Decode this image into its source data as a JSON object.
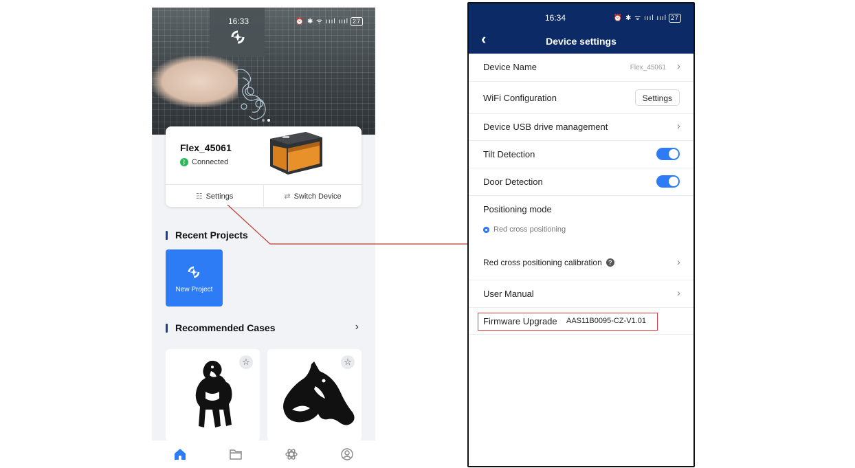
{
  "left_phone": {
    "status_bar": {
      "time": "16:33",
      "indicators": "⏰ ✱ ᯤ ıııl ıııl",
      "battery": "27"
    },
    "device": {
      "name": "Flex_45061",
      "status": "Connected"
    },
    "actions": {
      "settings": "Settings",
      "switch_device": "Switch Device"
    },
    "recent_projects": {
      "title": "Recent Projects",
      "new_project": "New Project"
    },
    "recommended": {
      "title": "Recommended Cases"
    },
    "tabbar_icons": [
      "home-icon",
      "folder-icon",
      "atom-icon",
      "profile-icon"
    ]
  },
  "right_phone": {
    "status_bar": {
      "time": "16:34",
      "indicators": "⏰ ✱ ᯤ ıııl ıııl",
      "battery": "27"
    },
    "title": "Device settings",
    "rows": {
      "device_name": {
        "label": "Device Name",
        "value": "Flex_45061"
      },
      "wifi": {
        "label": "WiFi Configuration",
        "button": "Settings"
      },
      "usb": {
        "label": "Device USB drive management"
      },
      "tilt": {
        "label": "Tilt Detection",
        "enabled": true
      },
      "door": {
        "label": "Door Detection",
        "enabled": true
      },
      "positioning": {
        "label": "Positioning mode",
        "option": "Red cross positioning"
      },
      "calibration": {
        "label": "Red cross positioning calibration"
      },
      "manual": {
        "label": "User Manual"
      },
      "firmware": {
        "label": "Firmware Upgrade",
        "version": "AAS11B0095-CZ-V1.01"
      }
    }
  },
  "colors": {
    "header_navy": "#0b2a66",
    "accent_blue": "#2d7cf6",
    "highlight_red": "#d9363e",
    "connected_green": "#2bb95b"
  }
}
